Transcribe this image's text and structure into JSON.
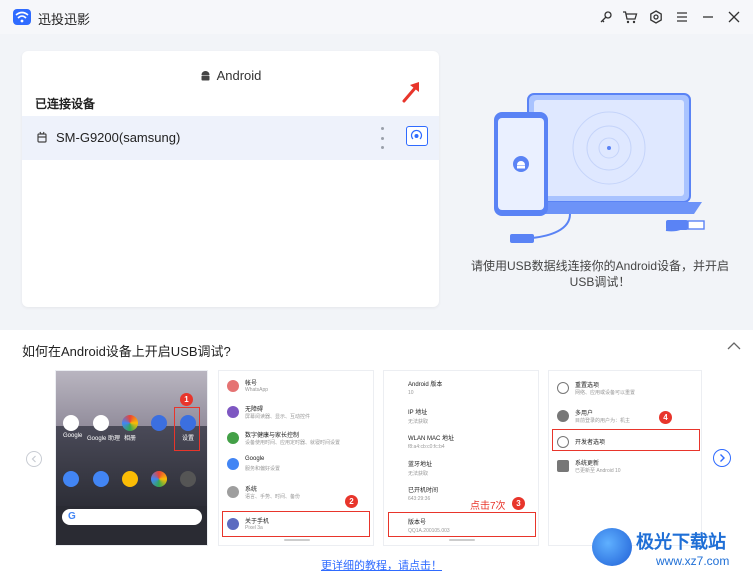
{
  "window": {
    "title": "迅投迅影",
    "controls": [
      "key-icon",
      "cart-icon",
      "settings-icon",
      "menu-icon",
      "minimize-icon",
      "close-icon"
    ]
  },
  "devices_panel": {
    "platform": "Android",
    "section_title": "已连接设备",
    "device_name": "SM-G9200(samsung)"
  },
  "hero": {
    "instruction": "请使用USB数据线连接你的Android设备，并开启USB调试！"
  },
  "help": {
    "title": "如何在Android设备上开启USB调试?",
    "tutorial_link": "更详细的教程，请点击！",
    "step_badges": [
      "1",
      "2",
      "3",
      "4"
    ],
    "tap_hint": "点击7次",
    "phone_apps_row1": [
      "Google",
      "Google 助理",
      "相册",
      "",
      "设置"
    ],
    "settings_list": [
      {
        "title": "帐号",
        "sub": "WhatsApp"
      },
      {
        "title": "无障碍",
        "sub": "屏幕阅读器、显示、互动控件"
      },
      {
        "title": "数字健康与家长控制",
        "sub": "设备使用时间、应用定时器、就寝时间设置"
      },
      {
        "title": "Google",
        "sub": "服务和偏好设置"
      },
      {
        "title": "系统",
        "sub": "语言、手势、时间、备份"
      },
      {
        "title": "关于手机",
        "sub": "Pixel 3a"
      }
    ],
    "about_list": [
      {
        "title": "Android 版本",
        "sub": "10"
      },
      {
        "title": "IP 地址",
        "sub": "无法获取"
      },
      {
        "title": "WLAN MAC 地址",
        "sub": "f8:a4:cb:c0:fc:b4"
      },
      {
        "title": "蓝牙地址",
        "sub": "无法获取"
      },
      {
        "title": "已开机时间",
        "sub": "643:29:36"
      },
      {
        "title": "版本号",
        "sub": "QQ1A.200105.003"
      }
    ],
    "system_list": [
      {
        "title": "重置选项",
        "sub": "网络、应用或设备可以重置"
      },
      {
        "title": "多用户",
        "sub": "目前登录的用户为：机主"
      },
      {
        "title": "开发者选项",
        "sub": ""
      },
      {
        "title": "系统更新",
        "sub": "已更新至 Android 10"
      }
    ]
  },
  "watermark": {
    "title": "极光下载站",
    "url": "www.xz7.com"
  },
  "colors": {
    "accent": "#2f6bff",
    "highlight_red": "#e8352b",
    "panel_bg": "#ffffff",
    "app_bg": "#f2f4f8"
  }
}
